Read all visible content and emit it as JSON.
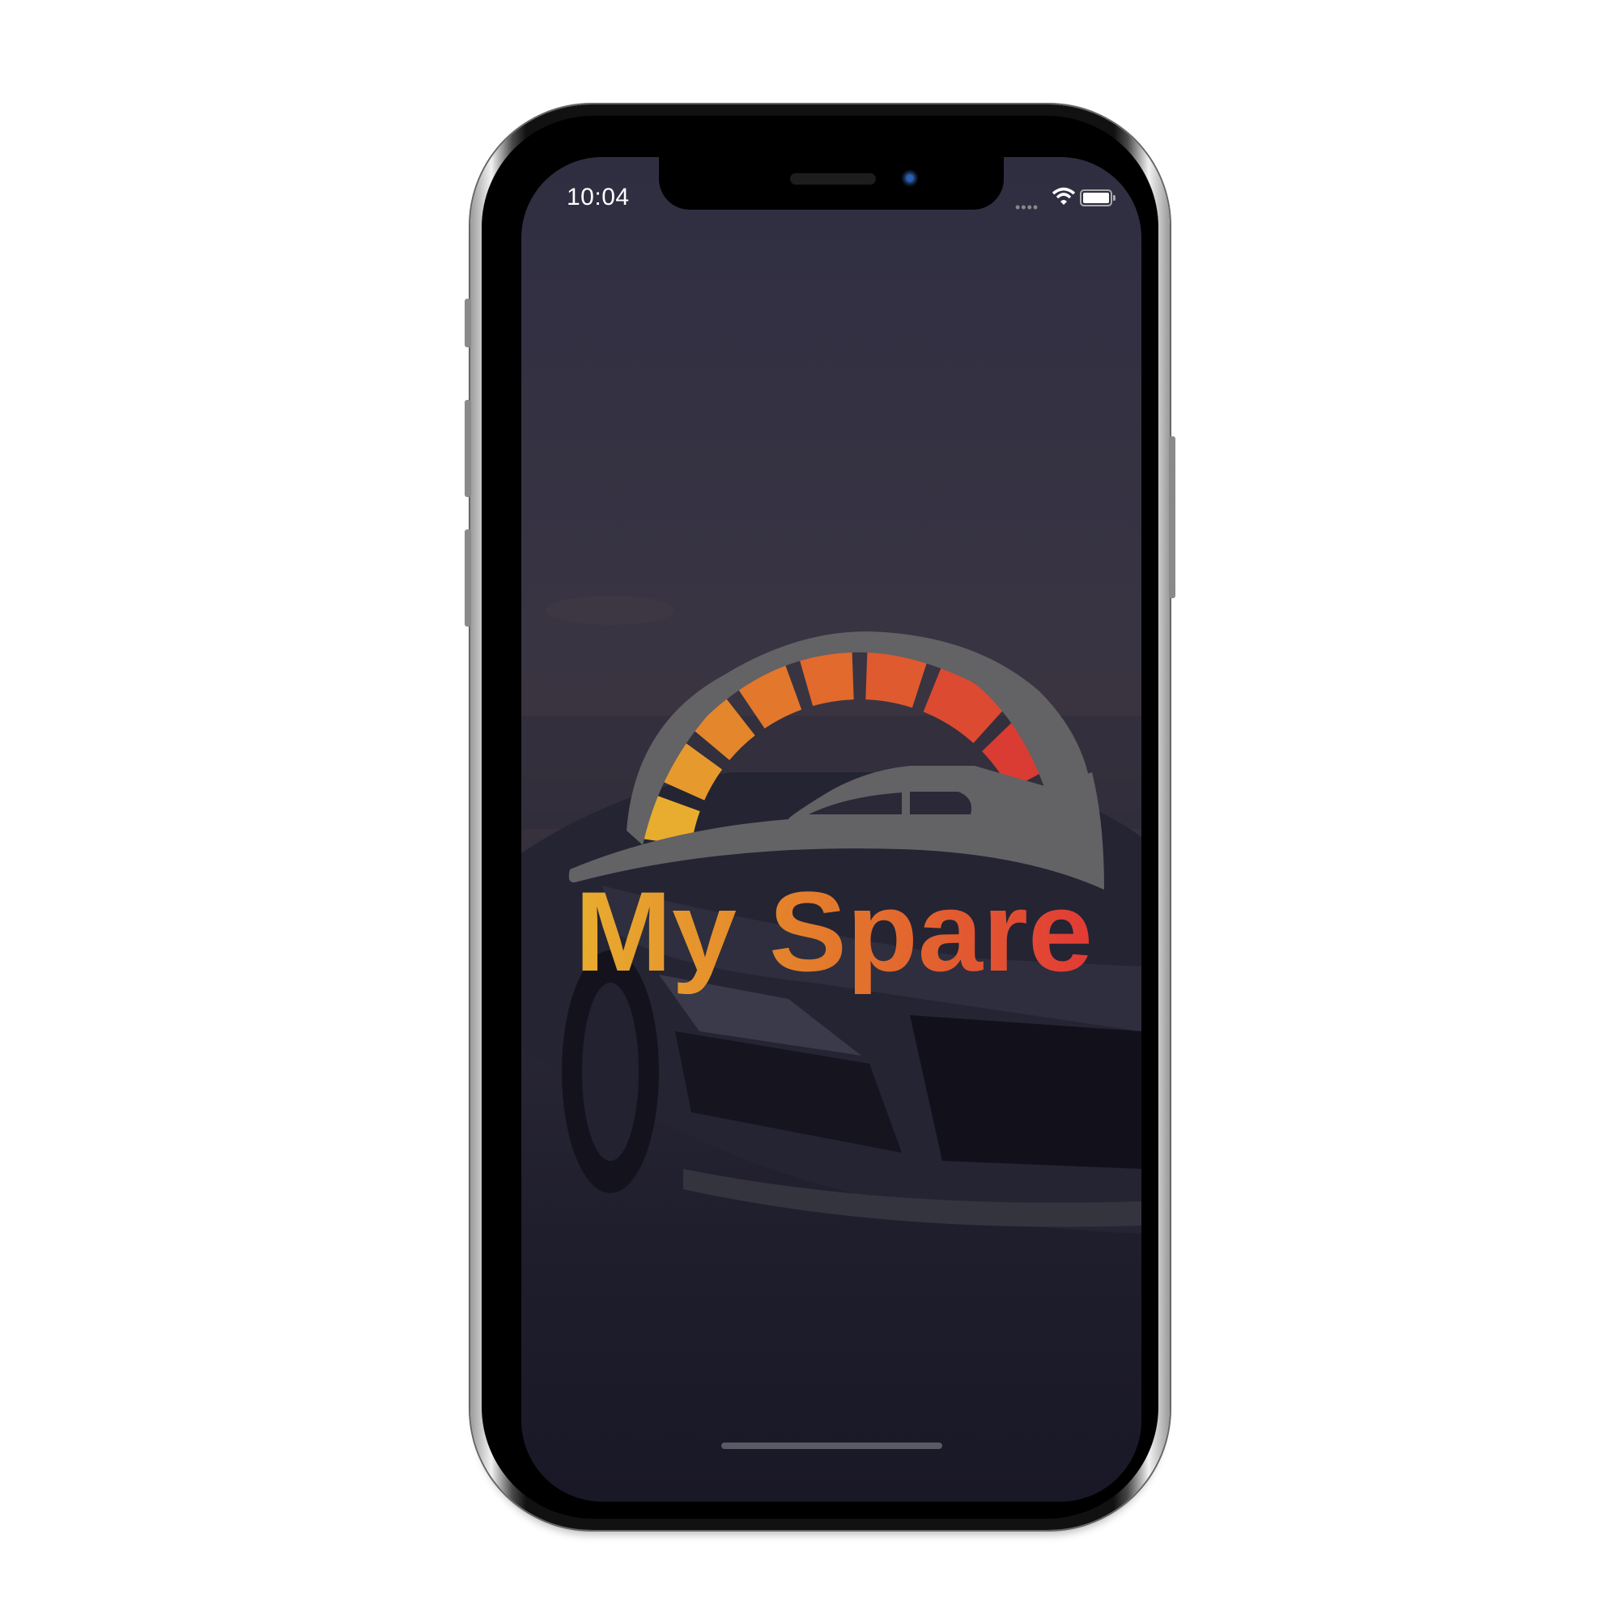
{
  "status_bar": {
    "time": "10:04",
    "signal_icon": "signal-dots-icon",
    "wifi_icon": "wifi-icon",
    "battery_icon": "battery-icon"
  },
  "splash": {
    "logo_text": "My Spare",
    "logo_icon": "speedometer-car-icon"
  },
  "colors": {
    "gradient_start": "#e8ad2e",
    "gradient_mid": "#e3782c",
    "gradient_end": "#e23a35",
    "logo_gray": "#636265"
  }
}
